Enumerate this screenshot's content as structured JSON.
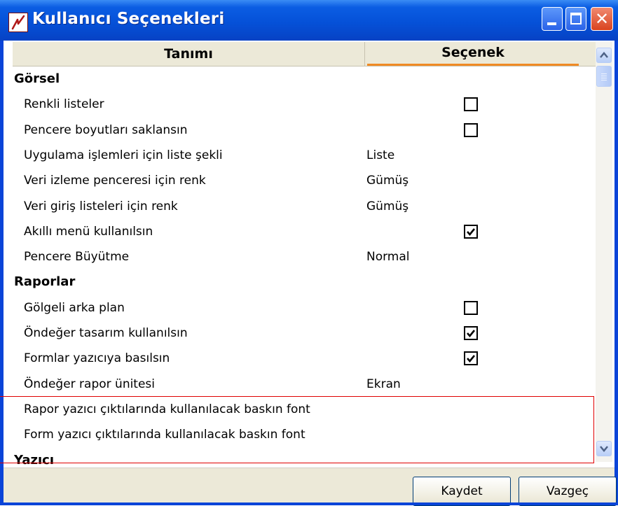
{
  "window": {
    "title": "Kullanıcı Seçenekleri",
    "close_glyph": "✕"
  },
  "grid": {
    "columns": [
      "Tanımı",
      "Seçenek"
    ],
    "rows": [
      {
        "type": "section",
        "label": "Görsel"
      },
      {
        "type": "checkbox",
        "label": "Renkli listeler",
        "checked": false
      },
      {
        "type": "checkbox",
        "label": "Pencere boyutları saklansın",
        "checked": false
      },
      {
        "type": "value",
        "label": "Uygulama işlemleri için liste şekli",
        "value": "Liste"
      },
      {
        "type": "value",
        "label": "Veri izleme penceresi için renk",
        "value": "Gümüş"
      },
      {
        "type": "value",
        "label": "Veri giriş listeleri için renk",
        "value": "Gümüş"
      },
      {
        "type": "checkbox",
        "label": "Akıllı menü kullanılsın",
        "checked": true
      },
      {
        "type": "value",
        "label": "Pencere Büyütme",
        "value": "Normal"
      },
      {
        "type": "section",
        "label": "Raporlar"
      },
      {
        "type": "checkbox",
        "label": "Gölgeli arka plan",
        "checked": false
      },
      {
        "type": "checkbox",
        "label": "Öndeğer tasarım kullanılsın",
        "checked": true
      },
      {
        "type": "checkbox",
        "label": "Formlar yazıcıya basılsın",
        "checked": true
      },
      {
        "type": "value",
        "label": "Öndeğer rapor ünitesi",
        "value": "Ekran"
      },
      {
        "type": "value",
        "label": "Rapor yazıcı çıktılarında kullanılacak baskın font",
        "value": ""
      },
      {
        "type": "value",
        "label": "Form yazıcı çıktılarında kullanılacak baskın font",
        "value": ""
      },
      {
        "type": "section",
        "label": "Yazıcı"
      }
    ]
  },
  "buttons": {
    "save": "Kaydet",
    "cancel": "Vazgeç"
  },
  "colors": {
    "title_bar": "#0551d8",
    "header_accent": "#f08a24",
    "highlight": "#e00000"
  }
}
